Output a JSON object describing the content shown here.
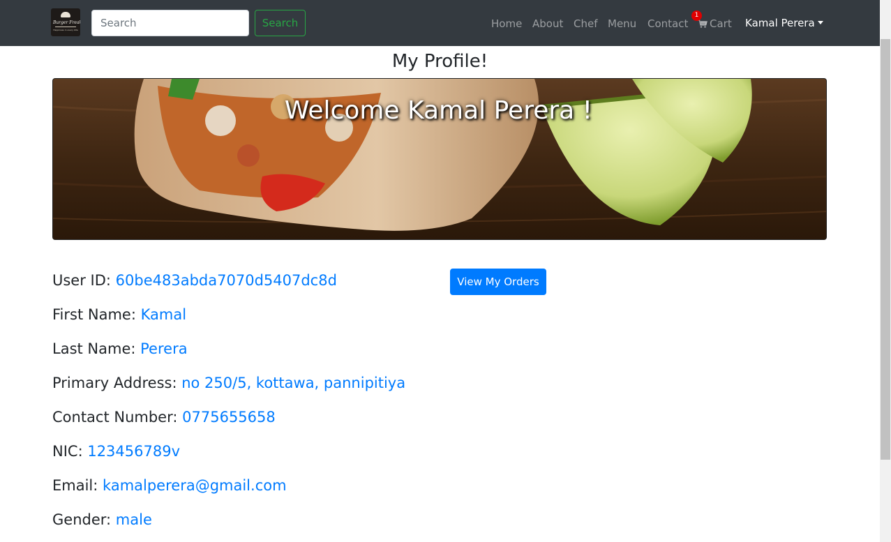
{
  "navbar": {
    "brand": {
      "logo_line1": "Burger Freaks",
      "logo_line2": "Happiness in every bite"
    },
    "search": {
      "placeholder": "Search",
      "button_label": "Search"
    },
    "links": {
      "home": "Home",
      "about": "About",
      "chef": "Chef",
      "menu": "Menu",
      "contact": "Contact",
      "cart": "Cart"
    },
    "cart_count": "1",
    "user_name": "Kamal Perera",
    "colors": {
      "bg": "#343a40",
      "search_accent": "#28a745",
      "badge": "#e00000"
    }
  },
  "page": {
    "title": "My Profile!",
    "welcome": "Welcome Kamal Perera !",
    "view_orders_label": "View My Orders"
  },
  "profile": {
    "user_id": {
      "label": "User ID:",
      "value": "60be483abda7070d5407dc8d"
    },
    "first_name": {
      "label": "First Name:",
      "value": "Kamal"
    },
    "last_name": {
      "label": "Last Name:",
      "value": "Perera"
    },
    "address": {
      "label": "Primary Address:",
      "value": "no 250/5, kottawa, pannipitiya"
    },
    "contact": {
      "label": "Contact Number:",
      "value": "0775655658"
    },
    "nic": {
      "label": "NIC:",
      "value": "123456789v"
    },
    "email": {
      "label": "Email:",
      "value": "kamalperera@gmail.com"
    },
    "gender": {
      "label": "Gender:",
      "value": "male"
    }
  },
  "icons": {
    "cart": "cart-icon",
    "dropdown": "caret-down-icon"
  },
  "accent_color": "#007bff"
}
